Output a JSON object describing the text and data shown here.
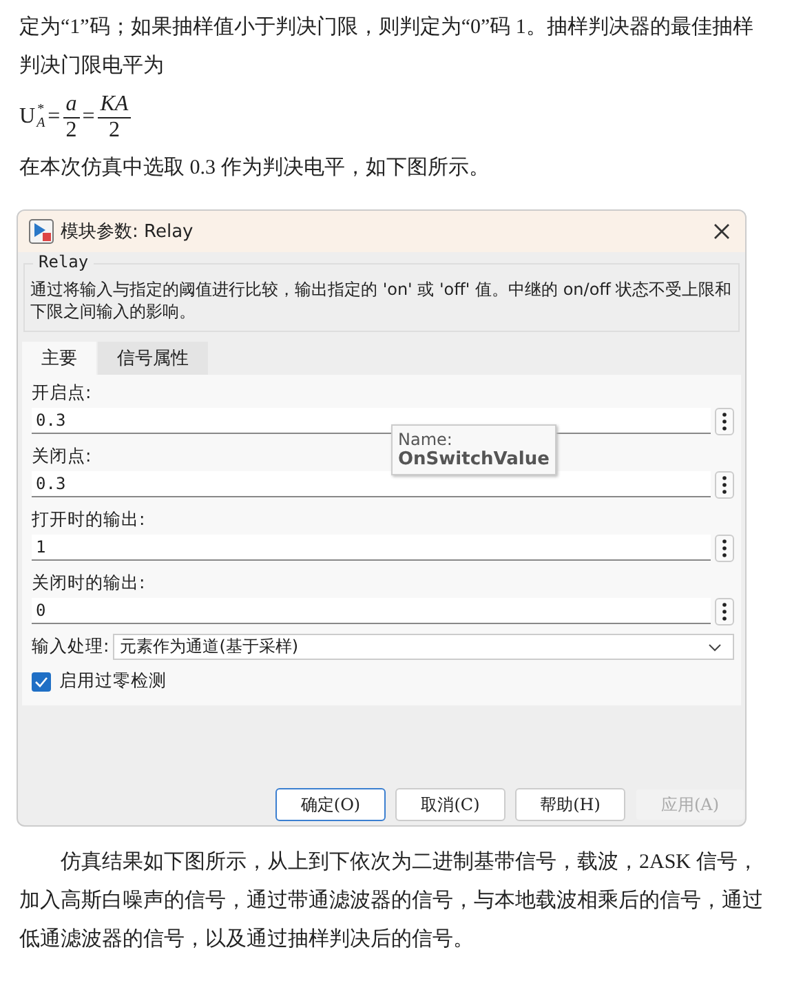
{
  "intro": "定为“1”码；如果抽样值小于判决门限，则判定为“0”码 1。抽样判决器的最佳抽样判决门限电平为",
  "formula": [
    {
      "kind": "symbol",
      "text": "U",
      "sub": "A",
      "sup": "*"
    },
    {
      "kind": "op",
      "text": "="
    },
    {
      "kind": "frac",
      "num": "a",
      "den": "2"
    },
    {
      "kind": "op",
      "text": "="
    },
    {
      "kind": "frac",
      "num": "KA",
      "den": "2"
    }
  ],
  "lead": "在本次仿真中选取 0.3 作为判决电平，如下图所示。",
  "dialog": {
    "title": "模块参数: Relay",
    "block_name": "Relay",
    "description": "通过将输入与指定的阈值进行比较，输出指定的 'on' 或 'off' 值。中继的 on/off 状态不受上限和下限之间输入的影响。",
    "tabs": [
      {
        "label": "主要",
        "selected": true
      },
      {
        "label": "信号属性",
        "selected": false
      }
    ],
    "fields": [
      {
        "label": "开启点:",
        "value": "0.3"
      },
      {
        "label": "关闭点:",
        "value": "0.3"
      },
      {
        "label": "打开时的输出:",
        "value": "1"
      },
      {
        "label": "关闭时的输出:",
        "value": "0"
      }
    ],
    "tooltip": {
      "caption": "Name:",
      "value": "OnSwitchValue"
    },
    "input_processing": {
      "label": "输入处理:",
      "value": "元素作为通道(基于采样)"
    },
    "zero_crossing": {
      "label": "启用过零检测",
      "checked": true
    },
    "buttons": [
      {
        "label": "确定(O)",
        "focused": true,
        "disabled": false
      },
      {
        "label": "取消(C)",
        "focused": false,
        "disabled": false
      },
      {
        "label": "帮助(H)",
        "focused": false,
        "disabled": false
      },
      {
        "label": "应用(A)",
        "focused": false,
        "disabled": true
      }
    ]
  },
  "result": "仿真结果如下图所示，从上到下依次为二进制基带信号，载波，2ASK 信号，加入高斯白噪声的信号，通过带通滤波器的信号，与本地载波相乘后的信号，通过低通滤波器的信号，以及通过抽样判决后的信号。"
}
